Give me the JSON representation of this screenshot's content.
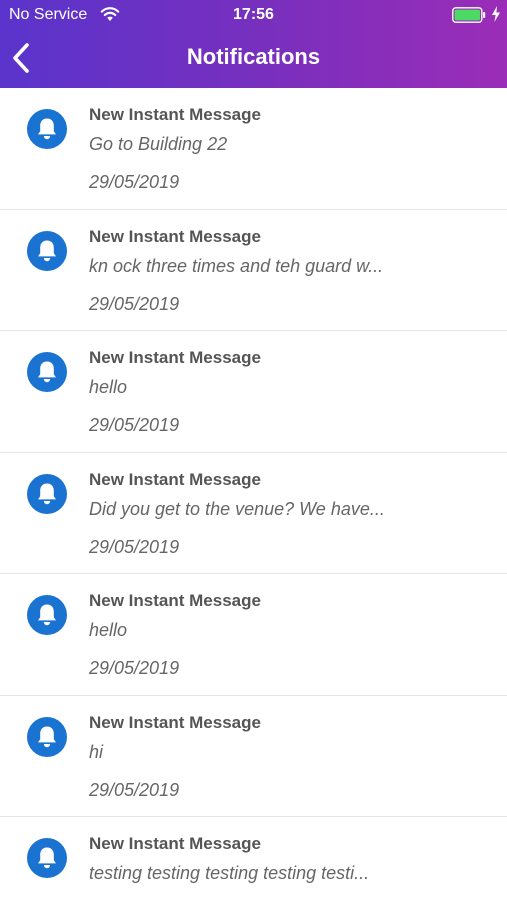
{
  "status_bar": {
    "carrier": "No Service",
    "time": "17:56",
    "battery_color": "#4cd964"
  },
  "nav": {
    "title": "Notifications",
    "back_icon": "chevron-left-icon"
  },
  "colors": {
    "header_gradient_start": "#5a34cc",
    "header_gradient_end": "#9b2db8",
    "bell_icon": "#1a73d1"
  },
  "notifications": [
    {
      "title": "New Instant Message",
      "message": "Go to Building 22",
      "date": "29/05/2019",
      "icon": "bell-icon"
    },
    {
      "title": "New Instant Message",
      "message": "kn ock three times and teh guard w...",
      "date": "29/05/2019",
      "icon": "bell-icon"
    },
    {
      "title": "New Instant Message",
      "message": "hello",
      "date": "29/05/2019",
      "icon": "bell-icon"
    },
    {
      "title": "New Instant Message",
      "message": "Did you get to the venue? We have...",
      "date": "29/05/2019",
      "icon": "bell-icon"
    },
    {
      "title": "New Instant Message",
      "message": "hello",
      "date": "29/05/2019",
      "icon": "bell-icon"
    },
    {
      "title": "New Instant Message",
      "message": "hi",
      "date": "29/05/2019",
      "icon": "bell-icon"
    },
    {
      "title": "New Instant Message",
      "message": "testing testing testing testing testi...",
      "date": "",
      "icon": "bell-icon"
    }
  ]
}
